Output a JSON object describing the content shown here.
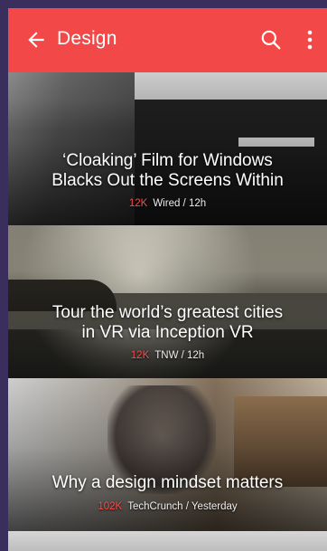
{
  "appbar": {
    "title": "Design",
    "back_icon": "arrow-left-icon",
    "search_icon": "search-icon",
    "more_icon": "more-vertical-icon",
    "color": "#f24848"
  },
  "articles": [
    {
      "headline_line1": "‘Cloaking’ Film for Windows",
      "headline_line2": "Blacks Out the Screens Within",
      "count": "12K",
      "source": "Wired / 12h"
    },
    {
      "headline_line1": "Tour the world’s greatest cities",
      "headline_line2": "in VR via Inception VR",
      "count": "12K",
      "source": "TNW / 12h"
    },
    {
      "headline_line1": "Why a design mindset matters",
      "count": "102K",
      "source": "TechCrunch / Yesterday"
    }
  ],
  "accent_count_color": "#ff4b4b"
}
